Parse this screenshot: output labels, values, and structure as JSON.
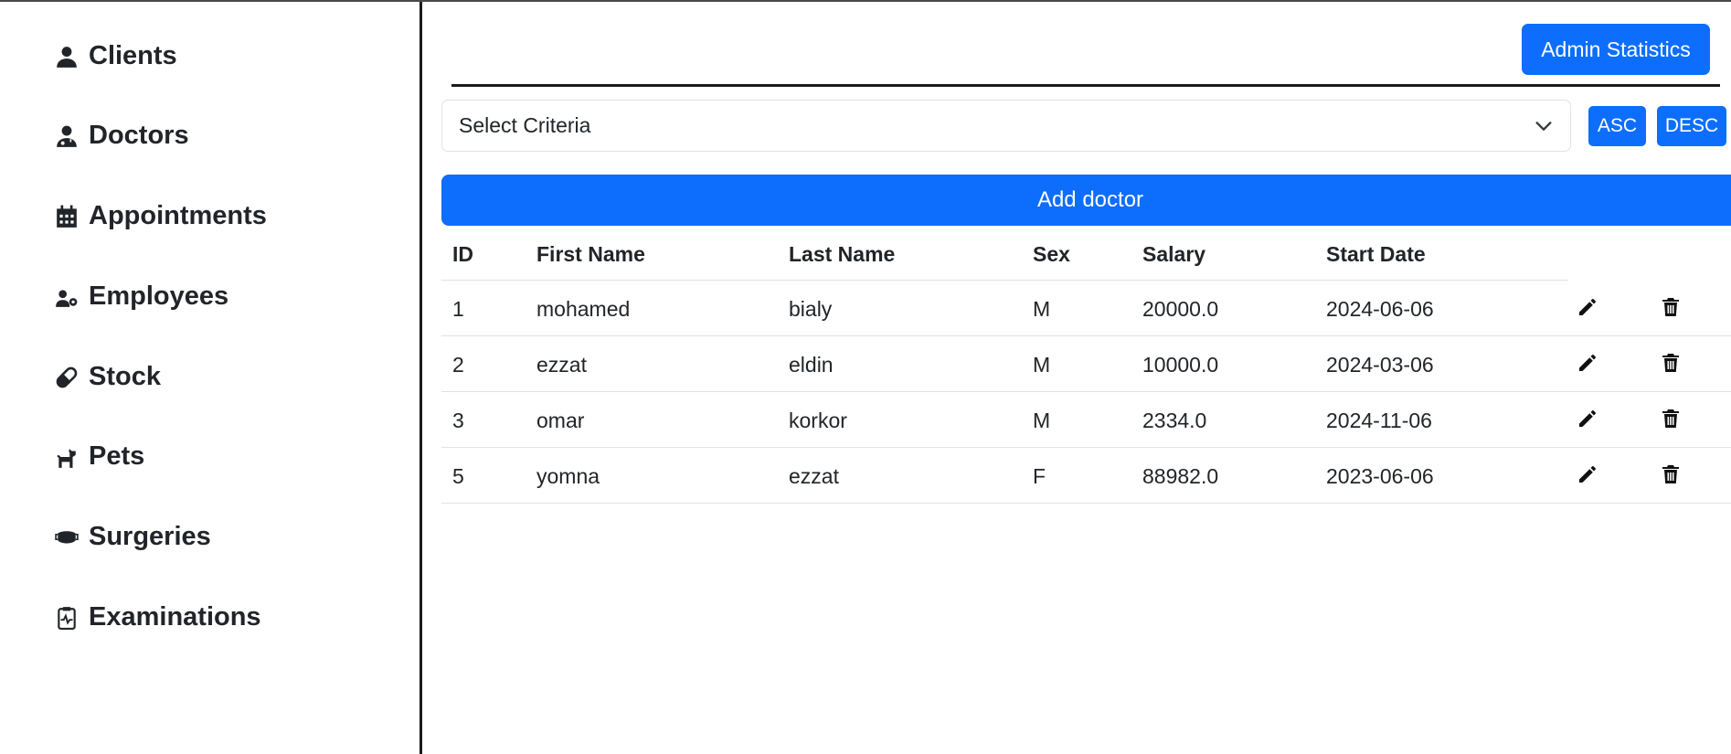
{
  "sidebar": {
    "items": [
      {
        "label": "Clients",
        "icon": "user-icon"
      },
      {
        "label": "Doctors",
        "icon": "user-doctor-icon"
      },
      {
        "label": "Appointments",
        "icon": "calendar-icon"
      },
      {
        "label": "Employees",
        "icon": "user-gear-icon"
      },
      {
        "label": "Stock",
        "icon": "pills-icon"
      },
      {
        "label": "Pets",
        "icon": "dog-icon"
      },
      {
        "label": "Surgeries",
        "icon": "mask-icon"
      },
      {
        "label": "Examinations",
        "icon": "clipboard-pulse-icon"
      }
    ]
  },
  "header": {
    "admin_button": "Admin Statistics"
  },
  "controls": {
    "select_value": "Select Criteria",
    "asc_label": "ASC",
    "desc_label": "DESC",
    "add_label": "Add doctor"
  },
  "table": {
    "headers": [
      "ID",
      "First Name",
      "Last Name",
      "Sex",
      "Salary",
      "Start Date"
    ],
    "rows": [
      {
        "id": "1",
        "first": "mohamed",
        "last": "bialy",
        "sex": "M",
        "salary": "20000.0",
        "start": "2024-06-06"
      },
      {
        "id": "2",
        "first": "ezzat",
        "last": "eldin",
        "sex": "M",
        "salary": "10000.0",
        "start": "2024-03-06"
      },
      {
        "id": "3",
        "first": "omar",
        "last": "korkor",
        "sex": "M",
        "salary": "2334.0",
        "start": "2024-11-06"
      },
      {
        "id": "5",
        "first": "yomna",
        "last": "ezzat",
        "sex": "F",
        "salary": "88982.0",
        "start": "2023-06-06"
      }
    ]
  },
  "colors": {
    "primary": "#0d6efd",
    "text": "#212529",
    "border": "#dee2e6"
  }
}
